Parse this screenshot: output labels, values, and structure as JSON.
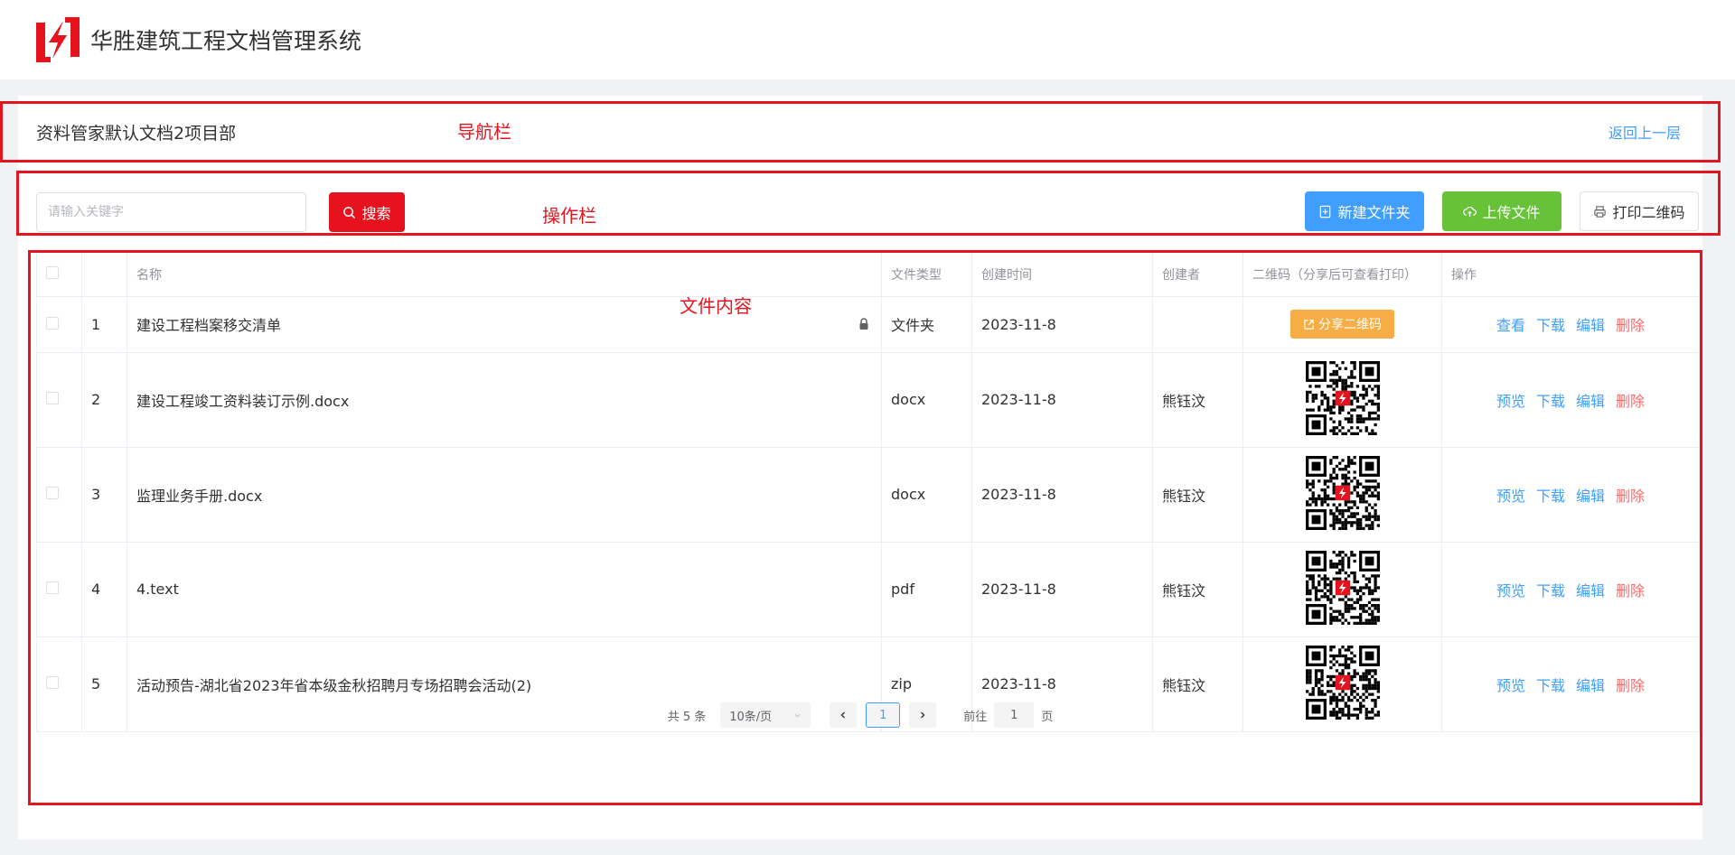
{
  "header": {
    "title": "华胜建筑工程文档管理系统"
  },
  "nav": {
    "breadcrumb": "资料管家默认文档2项目部",
    "back": "返回上一层"
  },
  "search": {
    "placeholder": "请输入关键字",
    "button": "搜索"
  },
  "actions": {
    "new_folder": "新建文件夹",
    "upload": "上传文件",
    "print_qr": "打印二维码"
  },
  "annotations": {
    "nav": "导航栏",
    "ops": "操作栏",
    "content": "文件内容"
  },
  "table": {
    "headers": {
      "name": "名称",
      "type": "文件类型",
      "created": "创建时间",
      "creator": "创建者",
      "qr": "二维码（分享后可查看打印）",
      "ops": "操作"
    },
    "rows": [
      {
        "index": "1",
        "name": "建设工程档案移交清单",
        "type": "文件夹",
        "date": "2023-11-8",
        "creator": "",
        "share": "分享二维码",
        "op1": "查看",
        "op2": "下载",
        "op3": "编辑",
        "op4": "删除"
      },
      {
        "index": "2",
        "name": "建设工程竣工资料装订示例.docx",
        "type": "docx",
        "date": "2023-11-8",
        "creator": "熊钰汶",
        "op1": "预览",
        "op2": "下载",
        "op3": "编辑",
        "op4": "删除"
      },
      {
        "index": "3",
        "name": "监理业务手册.docx",
        "type": "docx",
        "date": "2023-11-8",
        "creator": "熊钰汶",
        "op1": "预览",
        "op2": "下载",
        "op3": "编辑",
        "op4": "删除"
      },
      {
        "index": "4",
        "name": "4.text",
        "type": "pdf",
        "date": "2023-11-8",
        "creator": "熊钰汶",
        "op1": "预览",
        "op2": "下载",
        "op3": "编辑",
        "op4": "删除"
      },
      {
        "index": "5",
        "name": "活动预告-湖北省2023年省本级金秋招聘月专场招聘会活动(2)",
        "type": "zip",
        "date": "2023-11-8",
        "creator": "熊钰汶",
        "op1": "预览",
        "op2": "下载",
        "op3": "编辑",
        "op4": "删除"
      }
    ]
  },
  "pagination": {
    "total": "共 5 条",
    "page_size": "10条/页",
    "current": "1",
    "goto_label": "前往",
    "goto_value": "1",
    "page_suffix": "页"
  },
  "colors": {
    "brand_red": "#e6121d",
    "link_blue": "#409eff",
    "upload_green": "#67c23a",
    "share_orange": "#f6ad45",
    "delete_red": "#f56c6c"
  }
}
